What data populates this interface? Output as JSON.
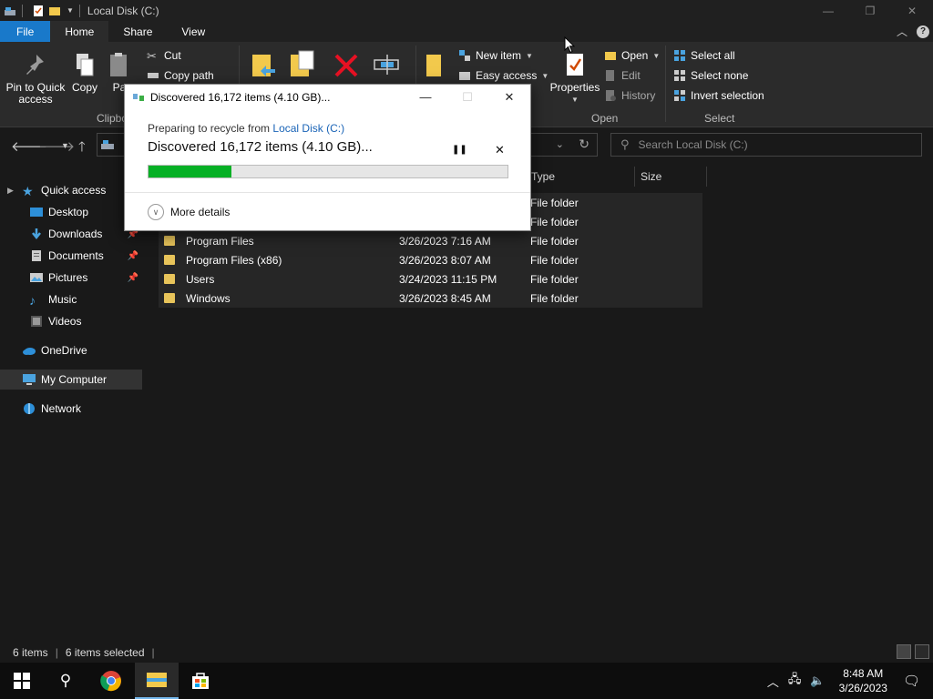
{
  "window": {
    "title": "Local Disk (C:)",
    "minimize": "—",
    "maximize": "❐",
    "close": "✕"
  },
  "ribbon_tabs": [
    "File",
    "Home",
    "Share",
    "View"
  ],
  "ribbon": {
    "pin_to_quick_access": "Pin to Quick access",
    "copy": "Copy",
    "paste": "Pa",
    "cut": "Cut",
    "copy_path": "Copy path",
    "clipboard_group": "Clipbo",
    "new_item": "New item",
    "easy_access": "Easy access",
    "properties": "Properties",
    "open": "Open",
    "edit": "Edit",
    "history": "History",
    "open_group": "Open",
    "select_all": "Select all",
    "select_none": "Select none",
    "invert_selection": "Invert selection",
    "select_group": "Select"
  },
  "search": {
    "placeholder": "Search Local Disk (C:)"
  },
  "sidebar": {
    "items": [
      {
        "label": "Quick access"
      },
      {
        "label": "Desktop"
      },
      {
        "label": "Downloads"
      },
      {
        "label": "Documents"
      },
      {
        "label": "Pictures"
      },
      {
        "label": "Music"
      },
      {
        "label": "Videos"
      },
      {
        "label": "OneDrive"
      },
      {
        "label": "My Computer"
      },
      {
        "label": "Network"
      }
    ]
  },
  "columns": {
    "type": "Type",
    "size": "Size"
  },
  "files": [
    {
      "name": "",
      "date": "",
      "type": "File folder"
    },
    {
      "name": "",
      "date": "",
      "type": "File folder"
    },
    {
      "name": "Program Files",
      "date": "3/26/2023 7:16 AM",
      "type": "File folder"
    },
    {
      "name": "Program Files (x86)",
      "date": "3/26/2023 8:07 AM",
      "type": "File folder"
    },
    {
      "name": "Users",
      "date": "3/24/2023 11:15 PM",
      "type": "File folder"
    },
    {
      "name": "Windows",
      "date": "3/26/2023 8:45 AM",
      "type": "File folder"
    }
  ],
  "status": {
    "items": "6 items",
    "selected": "6 items selected"
  },
  "dialog": {
    "title": "Discovered 16,172 items (4.10 GB)...",
    "preparing": "Preparing to recycle from ",
    "location": "Local Disk (C:)",
    "discovered": "Discovered 16,172 items (4.10 GB)...",
    "progress": 0.23,
    "more_details": "More details",
    "pause": "❚❚",
    "cancel": "✕"
  },
  "clock": {
    "time": "8:48 AM",
    "date": "3/26/2023"
  },
  "colors": {
    "accent": "#1979ca",
    "progress": "#06b025",
    "link": "#1a64b7"
  }
}
